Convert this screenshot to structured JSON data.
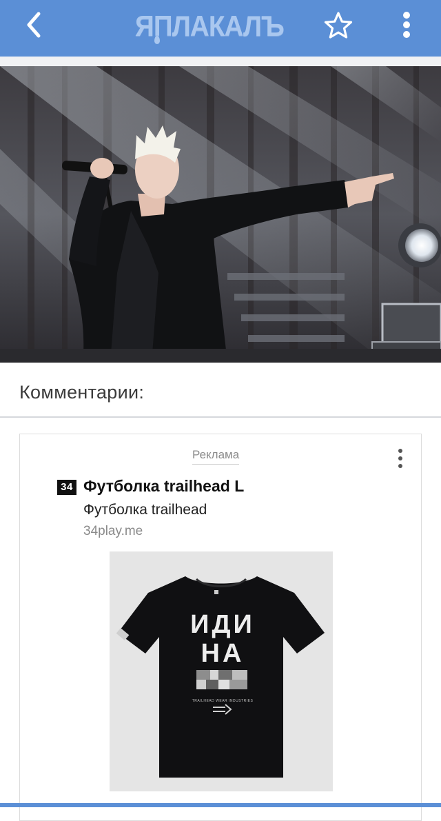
{
  "header": {
    "logo_text": "ЯПЛАКАЛЪ",
    "back_icon": "chevron-left-icon",
    "favorite_icon": "star-outline-icon",
    "menu_icon": "more-vertical-icon",
    "bar_color": "#5b8fd6",
    "logo_color": "#a9c7ef"
  },
  "post": {
    "image_description_icon": "photo"
  },
  "comments": {
    "title": "Комментарии:"
  },
  "ad": {
    "label": "Реклама",
    "favicon_text": "34",
    "title": "Футболка trailhead L",
    "subtitle": "Футболка trailhead",
    "domain": "34play.me",
    "shirt_line1": "ИДИ",
    "shirt_line2": "НА",
    "shirt_line3": "Х?Й",
    "shirt_small_text": "TRAILHEAD WEAR INDUSTRIES"
  }
}
